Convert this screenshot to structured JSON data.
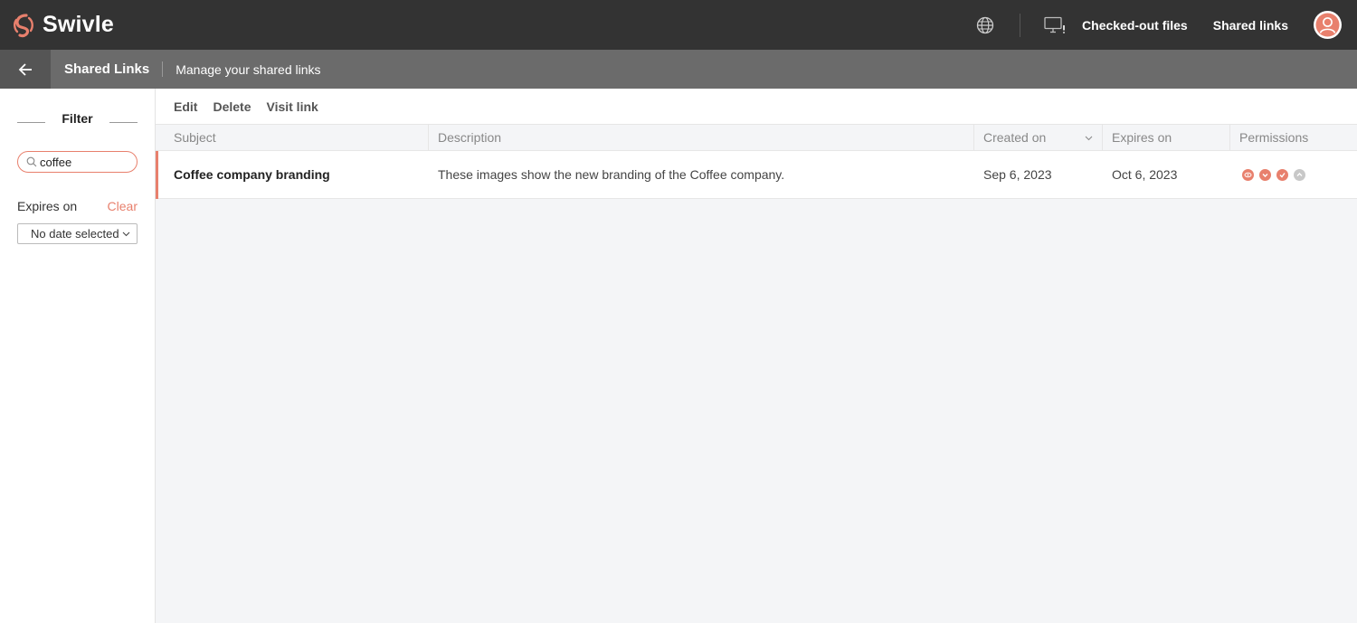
{
  "app": {
    "name": "Swivle",
    "brand_color": "#e8806d"
  },
  "topbar": {
    "checked_out_files": "Checked-out files",
    "shared_links": "Shared links"
  },
  "subbar": {
    "title": "Shared Links",
    "description": "Manage your shared links"
  },
  "sidebar": {
    "filter_label": "Filter",
    "search": {
      "value": "coffee",
      "placeholder": ""
    },
    "expires_label": "Expires on",
    "clear_label": "Clear",
    "date_select_value": "No date selected"
  },
  "toolbar": {
    "edit": "Edit",
    "delete": "Delete",
    "visit_link": "Visit link"
  },
  "table": {
    "columns": [
      "Subject",
      "Description",
      "Created on",
      "Expires on",
      "Permissions"
    ],
    "rows": [
      {
        "subject": "Coffee company branding",
        "description": "These images show the new branding of the Coffee company.",
        "created_on": "Sep 6, 2023",
        "expires_on": "Oct 6, 2023",
        "permissions": [
          {
            "icon": "view-icon",
            "enabled": true
          },
          {
            "icon": "download-icon",
            "enabled": true
          },
          {
            "icon": "download-icon",
            "enabled": true
          },
          {
            "icon": "upload-icon",
            "enabled": false
          }
        ]
      }
    ]
  }
}
